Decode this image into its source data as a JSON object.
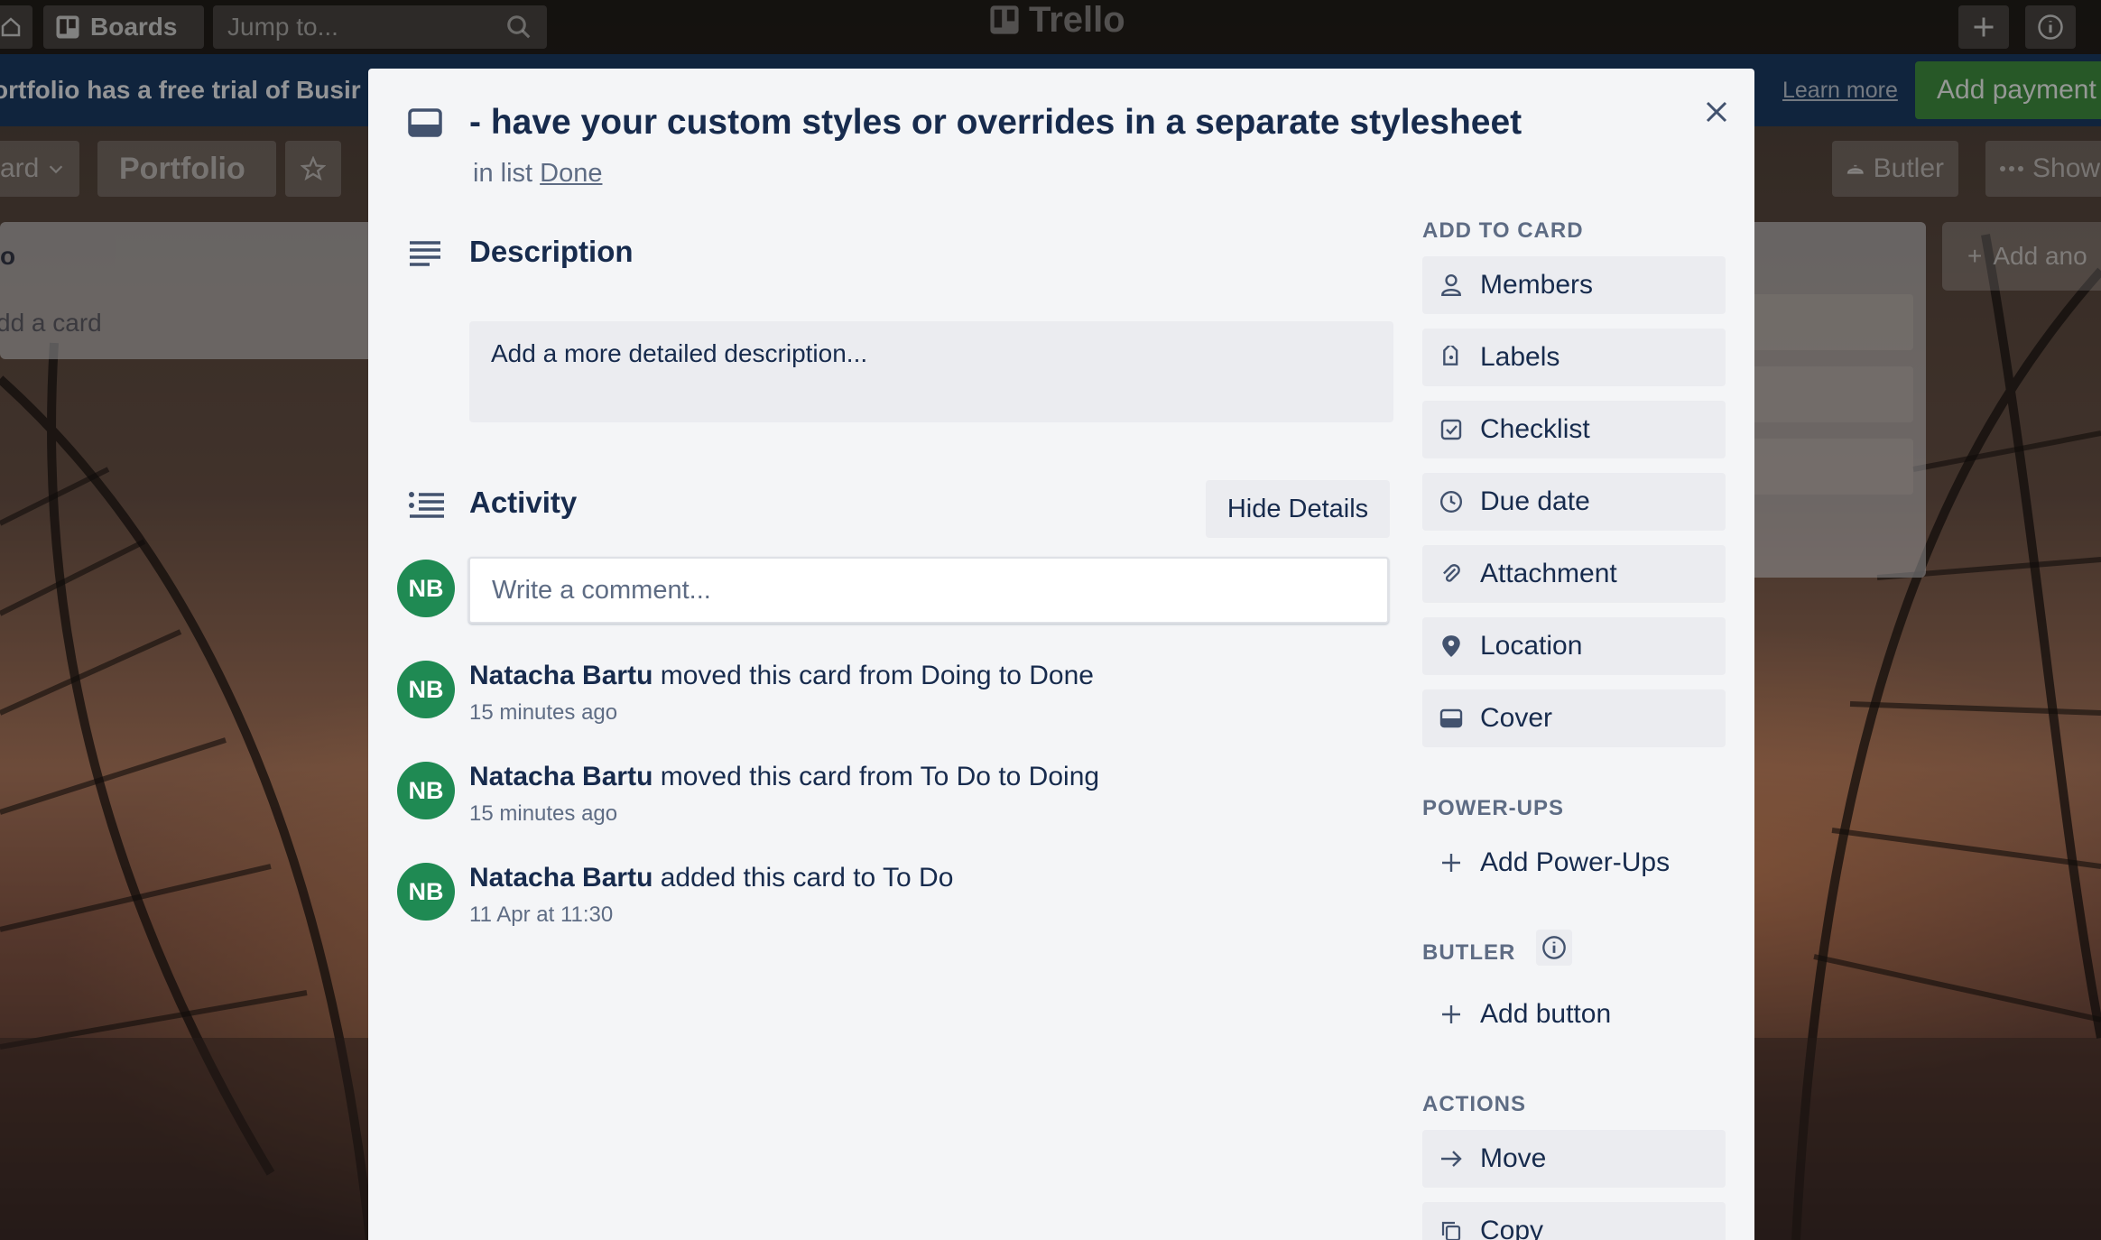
{
  "app": {
    "boards_label": "Boards",
    "search_placeholder": "Jump to...",
    "logo": "Trello"
  },
  "banner": {
    "message": "ortfolio has a free trial of Busir",
    "learn_more": "Learn more",
    "add_payment": "Add payment"
  },
  "board": {
    "menu_label": "ard",
    "name": "Portfolio",
    "butler": "Butler",
    "show_menu": "Show",
    "list_title": "o",
    "add_card": "dd a card",
    "add_list": "Add ano"
  },
  "card": {
    "title": "- have your custom styles or overrides in a separate stylesheet",
    "in_list_prefix": "in list",
    "list_name": "Done"
  },
  "description": {
    "heading": "Description",
    "placeholder": "Add a more detailed description..."
  },
  "activity": {
    "heading": "Activity",
    "hide_details": "Hide Details",
    "comment_placeholder": "Write a comment...",
    "user_initials": "NB",
    "items": [
      {
        "user": "Natacha Bartu",
        "text": " moved this card from Doing to Done",
        "time": "15 minutes ago"
      },
      {
        "user": "Natacha Bartu",
        "text": " moved this card from To Do to Doing",
        "time": "15 minutes ago"
      },
      {
        "user": "Natacha Bartu",
        "text": " added this card to To Do",
        "time": "11 Apr at 11:30"
      }
    ]
  },
  "sidebar": {
    "add_to_card_heading": "ADD TO CARD",
    "add_to_card": [
      "Members",
      "Labels",
      "Checklist",
      "Due date",
      "Attachment",
      "Location",
      "Cover"
    ],
    "powerups_heading": "POWER-UPS",
    "add_powerups": "Add Power-Ups",
    "butler_heading": "BUTLER",
    "add_button": "Add button",
    "actions_heading": "ACTIONS",
    "actions": [
      "Move",
      "Copy"
    ]
  }
}
